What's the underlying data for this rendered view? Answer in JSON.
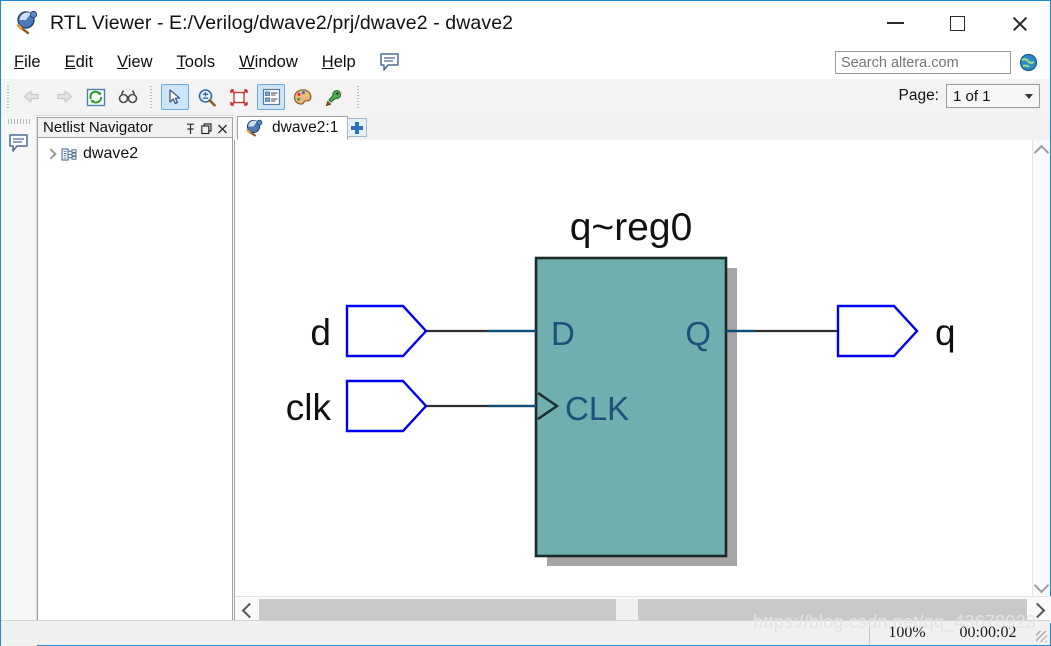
{
  "window": {
    "title": "RTL Viewer - E:/Verilog/dwave2/prj/dwave2 - dwave2",
    "app_icon": "rtl-viewer-icon",
    "minimize_label": "Minimize",
    "maximize_label": "Maximize",
    "close_label": "Close"
  },
  "menu": {
    "items": [
      {
        "mnemonic": "F",
        "rest": "ile"
      },
      {
        "mnemonic": "E",
        "rest": "dit"
      },
      {
        "mnemonic": "V",
        "rest": "iew"
      },
      {
        "mnemonic": "T",
        "rest": "ools"
      },
      {
        "mnemonic": "W",
        "rest": "indow"
      },
      {
        "mnemonic": "H",
        "rest": "elp"
      }
    ],
    "bubble_icon": "speech-bubble-icon"
  },
  "search": {
    "placeholder": "Search altera.com",
    "value": "",
    "globe_icon": "globe-icon"
  },
  "toolbar": {
    "buttons": [
      {
        "name": "back-icon",
        "state": "disabled"
      },
      {
        "name": "forward-icon",
        "state": "disabled"
      },
      {
        "name": "refresh-icon",
        "state": "normal"
      },
      {
        "name": "find-icon",
        "state": "normal"
      },
      {
        "name": "select-tool-icon",
        "state": "selected"
      },
      {
        "name": "zoom-tool-icon",
        "state": "normal"
      },
      {
        "name": "fit-page-icon",
        "state": "normal"
      },
      {
        "name": "hierarchy-list-icon",
        "state": "selected"
      },
      {
        "name": "color-palette-icon",
        "state": "normal"
      },
      {
        "name": "bird-probe-icon",
        "state": "normal"
      }
    ]
  },
  "page_control": {
    "label": "Page:",
    "value": "1 of 1"
  },
  "left_strip": {
    "icon": "speech-bubble-icon"
  },
  "netlist_panel": {
    "title": "Netlist Navigator",
    "pin_icon": "pin-icon",
    "float_icon": "restore-icon",
    "close_icon": "close-icon",
    "tree": [
      {
        "label": "dwave2",
        "icon": "module-icon",
        "expanded": false
      }
    ]
  },
  "tabs": {
    "items": [
      {
        "label": "dwave2:1",
        "icon": "rtl-viewer-icon",
        "active": true
      }
    ],
    "add_tab_label": "+"
  },
  "schematic": {
    "inputs": [
      {
        "label": "d",
        "port_type": "input"
      },
      {
        "label": "clk",
        "port_type": "input"
      }
    ],
    "outputs": [
      {
        "label": "q",
        "port_type": "output"
      }
    ],
    "block": {
      "name": "q~reg0",
      "pins_left": [
        "D",
        "CLK"
      ],
      "pins_right": [
        "Q"
      ],
      "fill_color": "#6fafb0",
      "border_color": "#1b2b2b",
      "shadow_color": "#a6a6a6",
      "pin_text_color": "#1f4f7a"
    },
    "port_outline_color": "#0000ee",
    "wire_color": "#2e2e2e",
    "wire_color_near_block": "#0b4f7a"
  },
  "status_bar": {
    "zoom": "100%",
    "time": "00:00:02"
  },
  "watermark": {
    "text": "https://blog.csdn.net/qq_43678923"
  }
}
